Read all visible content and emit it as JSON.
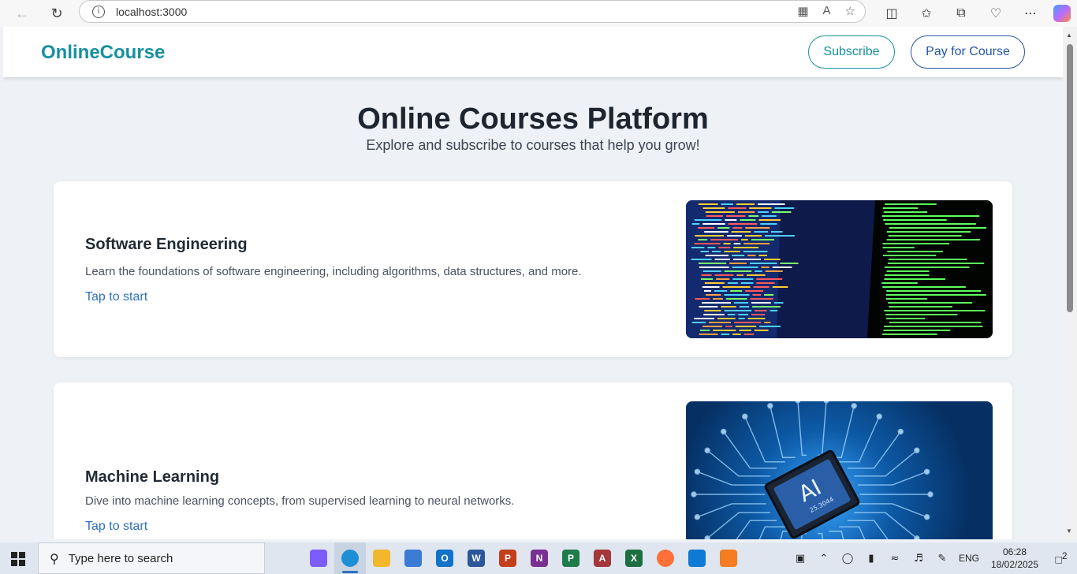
{
  "browser": {
    "url": "localhost:3000",
    "icons": [
      "back-icon",
      "reload-icon",
      "info-icon",
      "apps-icon",
      "read-aloud-icon",
      "favorite-icon",
      "split-screen-icon",
      "favorites-icon",
      "collections-icon",
      "performance-icon",
      "more-icon",
      "copilot-icon"
    ]
  },
  "header": {
    "brand": "OnlineCourse",
    "subscribe_label": "Subscribe",
    "pay_label": "Pay for Course"
  },
  "hero": {
    "title": "Online Courses Platform",
    "subtitle": "Explore and subscribe to courses that help you grow!"
  },
  "courses": [
    {
      "title": "Software Engineering",
      "description": "Learn the foundations of software engineering, including algorithms, data structures, and more.",
      "link": "Tap to start",
      "image": "code-screen-image"
    },
    {
      "title": "Machine Learning",
      "description": "Dive into machine learning concepts, from supervised learning to neural networks.",
      "link": "Tap to start",
      "image": "ai-chip-image",
      "chip_label": "AI",
      "chip_code": "25.3044"
    }
  ],
  "taskbar": {
    "search_placeholder": "Type here to search",
    "apps": [
      {
        "name": "task-view",
        "label": "",
        "color": "#dfe6ef"
      },
      {
        "name": "copilot",
        "label": "",
        "color": "#7a5cff"
      },
      {
        "name": "edge",
        "label": "",
        "color": "#1e8fd6"
      },
      {
        "name": "file-explorer",
        "label": "",
        "color": "#f1b82d"
      },
      {
        "name": "store",
        "label": "",
        "color": "#3b7bd4"
      },
      {
        "name": "outlook",
        "label": "O",
        "color": "#1272c9"
      },
      {
        "name": "word",
        "label": "W",
        "color": "#2b579a"
      },
      {
        "name": "powerpoint",
        "label": "P",
        "color": "#c43e1c"
      },
      {
        "name": "onenote",
        "label": "N",
        "color": "#7a2f93"
      },
      {
        "name": "project",
        "label": "P",
        "color": "#1f7a4c"
      },
      {
        "name": "access",
        "label": "A",
        "color": "#a4373a"
      },
      {
        "name": "excel",
        "label": "X",
        "color": "#1d6f42"
      },
      {
        "name": "firefox",
        "label": "",
        "color": "#ff7139"
      },
      {
        "name": "vscode",
        "label": "",
        "color": "#0e7ad3"
      },
      {
        "name": "xampp",
        "label": "",
        "color": "#f57c20"
      }
    ],
    "language": "ENG",
    "time": "06:28",
    "date": "18/02/2025",
    "notification_count": "2"
  }
}
